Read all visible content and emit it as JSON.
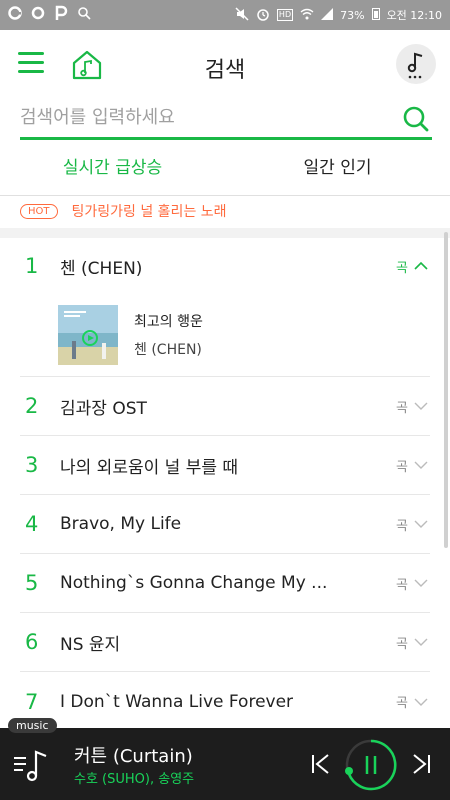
{
  "status_bar": {
    "left_icons": [
      "G",
      "O",
      "P",
      "search-icon"
    ],
    "battery": "73%",
    "time": "오전 12:10"
  },
  "header": {
    "title": "검색"
  },
  "search": {
    "placeholder": "검색어를 입력하세요"
  },
  "tabs": [
    {
      "label": "실시간 급상승",
      "active": true
    },
    {
      "label": "일간 인기",
      "active": false
    }
  ],
  "hot": {
    "badge": "HOT",
    "text": "팅가링가링 널 홀리는 노래"
  },
  "rankings": [
    {
      "rank": "1",
      "keyword": "첸 (CHEN)",
      "category": "곡",
      "expanded": true,
      "album": {
        "title": "최고의 행운",
        "artist": "첸 (CHEN)"
      }
    },
    {
      "rank": "2",
      "keyword": "김과장 OST",
      "category": "곡"
    },
    {
      "rank": "3",
      "keyword": "나의 외로움이 널 부를 때",
      "category": "곡"
    },
    {
      "rank": "4",
      "keyword": "Bravo, My Life",
      "category": "곡"
    },
    {
      "rank": "5",
      "keyword": "Nothing`s Gonna Change My ...",
      "category": "곡"
    },
    {
      "rank": "6",
      "keyword": "NS 윤지",
      "category": "곡"
    },
    {
      "rank": "7",
      "keyword": "I Don`t Wanna Live Forever",
      "category": "곡"
    }
  ],
  "player": {
    "tag": "music",
    "title": "커튼 (Curtain)",
    "artist": "수호 (SUHO), 송영주"
  },
  "colors": {
    "accent": "#19b846",
    "hot": "#ff6a3d",
    "player_bg": "#1d1d1d"
  }
}
